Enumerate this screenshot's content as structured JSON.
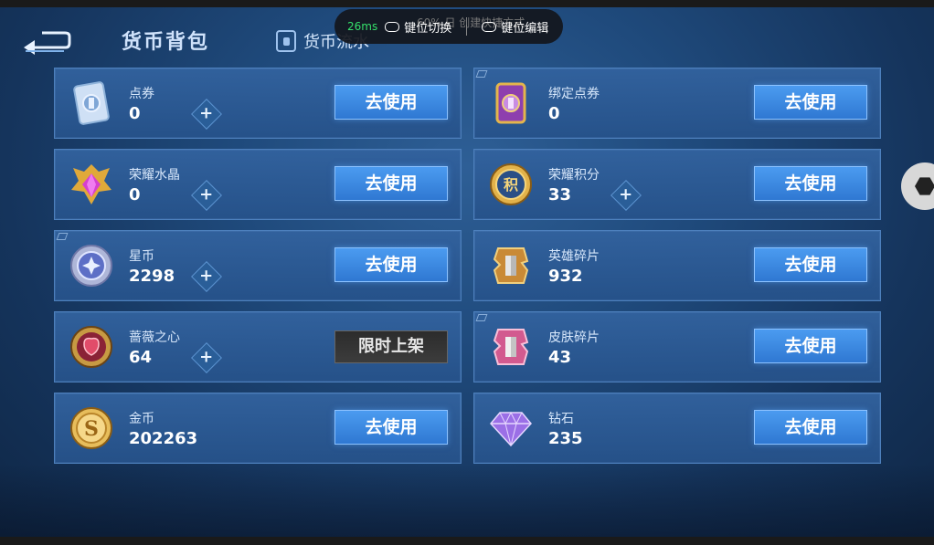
{
  "header": {
    "title": "货币背包",
    "flow_tab": "货币流水",
    "back_icon": "back-arrow-icon"
  },
  "overlay": {
    "ping": "26ms",
    "ghost_text": "60% 日 创建快捷方式",
    "switch_label": "键位切换",
    "edit_label": "键位编辑"
  },
  "currencies": [
    {
      "name": "点券",
      "amount": "0",
      "icon": "voucher-card-icon",
      "plus": true,
      "action": "去使用"
    },
    {
      "name": "绑定点券",
      "amount": "0",
      "icon": "bound-voucher-card-icon",
      "plus": false,
      "action": "去使用"
    },
    {
      "name": "荣耀水晶",
      "amount": "0",
      "icon": "glory-crystal-icon",
      "plus": true,
      "action": "去使用"
    },
    {
      "name": "荣耀积分",
      "amount": "33",
      "icon": "glory-points-icon",
      "plus": true,
      "action": "去使用"
    },
    {
      "name": "星币",
      "amount": "2298",
      "icon": "star-coin-icon",
      "plus": true,
      "action": "去使用"
    },
    {
      "name": "英雄碎片",
      "amount": "932",
      "icon": "hero-fragment-icon",
      "plus": false,
      "action": "去使用"
    },
    {
      "name": "蔷薇之心",
      "amount": "64",
      "icon": "rose-heart-icon",
      "plus": true,
      "action": "限时上架"
    },
    {
      "name": "皮肤碎片",
      "amount": "43",
      "icon": "skin-fragment-icon",
      "plus": false,
      "action": "去使用"
    },
    {
      "name": "金币",
      "amount": "202263",
      "icon": "gold-coin-icon",
      "plus": false,
      "action": "去使用"
    },
    {
      "name": "钻石",
      "amount": "235",
      "icon": "diamond-icon",
      "plus": false,
      "action": "去使用"
    }
  ],
  "colors": {
    "accent": "#3a86dc",
    "card": "#2f619c",
    "ping": "#35e06b"
  }
}
